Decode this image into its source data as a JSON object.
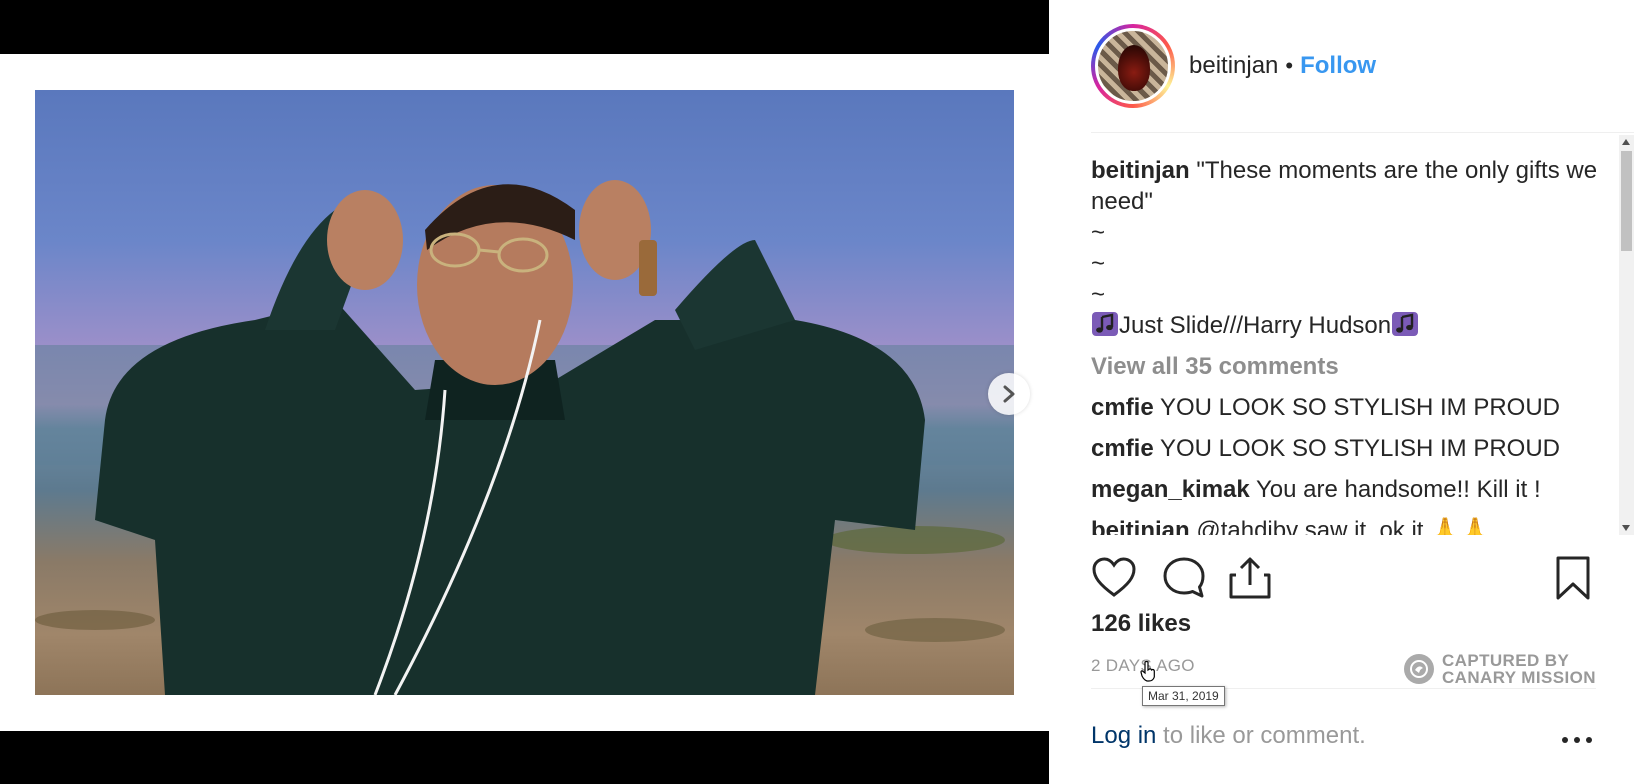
{
  "post": {
    "username": "beitinjan",
    "separator": "•",
    "follow_label": "Follow",
    "caption_user": "beitinjan",
    "caption_text": "\"These moments are the only gifts we need\"",
    "caption_tilde_1": "~",
    "caption_tilde_2": "~",
    "caption_tilde_3": "~",
    "caption_song": "Just Slide///Harry Hudson",
    "view_all_comments": "View all 35 comments",
    "comments": [
      {
        "user": "cmfie",
        "text": "YOU LOOK SO STYLISH IM PROUD"
      },
      {
        "user": "cmfie",
        "text": "YOU LOOK SO STYLISH IM PROUD"
      },
      {
        "user": "megan_kimak",
        "text": "You are handsome!! Kill it !"
      }
    ],
    "partial_comment_user": "beitinjan",
    "partial_comment_text": "@tahdjbv saw it, ok it 🙏🙏",
    "likes": "126 likes",
    "time_ago": "2 DAYS AGO",
    "tooltip_date": "Mar 31, 2019",
    "watermark_line1": "CAPTURED BY",
    "watermark_line2": "CANARY MISSION",
    "login_link": "Log in",
    "login_suffix": " to like or comment."
  },
  "icons": {
    "like": "heart-icon",
    "comment": "comment-bubble-icon",
    "share": "share-icon",
    "save": "bookmark-icon",
    "next": "chevron-right-icon",
    "more": "more-options-icon",
    "music": "music-note-icon"
  },
  "colors": {
    "follow": "#3897f0",
    "login_link": "#003569",
    "muted": "#999999",
    "text": "#262626"
  }
}
